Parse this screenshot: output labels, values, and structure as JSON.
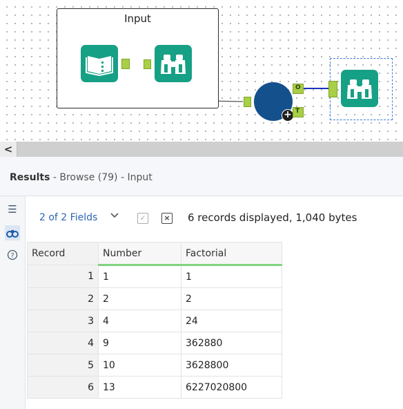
{
  "canvas": {
    "container_title": "Input",
    "connection_labels": {
      "output_o": "O",
      "output_t": "T"
    }
  },
  "scrollbar": {
    "left_arrow": "<"
  },
  "results": {
    "title": "Results",
    "subtitle": " - Browse (79) - Input"
  },
  "toolbar": {
    "fields_label": "2 of 2 Fields",
    "records_info": "6 records displayed, 1,040 bytes"
  },
  "table": {
    "headers": [
      "Record",
      "Number",
      "Factorial"
    ],
    "rows": [
      [
        "1",
        "1",
        "1"
      ],
      [
        "2",
        "2",
        "2"
      ],
      [
        "3",
        "4",
        "24"
      ],
      [
        "4",
        "9",
        "362880"
      ],
      [
        "5",
        "10",
        "3628800"
      ],
      [
        "6",
        "13",
        "6227020800"
      ]
    ]
  },
  "colors": {
    "tool_green": "#16a085",
    "anchor_green": "#a8cf45",
    "formula_blue": "#14508c",
    "link_blue": "#2a66b0"
  }
}
